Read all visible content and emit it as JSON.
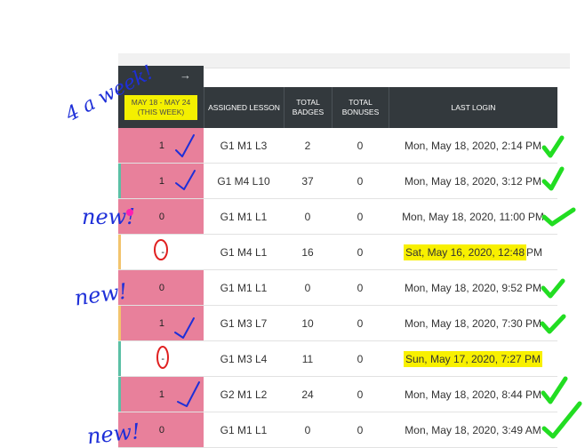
{
  "header": {
    "arrow": "→",
    "week_label_line1": "MAY 18 - MAY 24",
    "week_label_line2": "(THIS WEEK)",
    "assigned_lesson": "ASSIGNED LESSON",
    "total_badges": "TOTAL BADGES",
    "total_bonuses": "TOTAL BONUSES",
    "last_login": "LAST LOGIN"
  },
  "rows": [
    {
      "week": "1",
      "lesson": "G1 M1 L3",
      "badges": "2",
      "bonuses": "0",
      "login": "Mon, May 18, 2020, 2:14 PM"
    },
    {
      "week": "1",
      "lesson": "G1 M4 L10",
      "badges": "37",
      "bonuses": "0",
      "login": "Mon, May 18, 2020, 3:12 PM"
    },
    {
      "week": "0",
      "lesson": "G1 M1 L1",
      "badges": "0",
      "bonuses": "0",
      "login": "Mon, May 18, 2020, 11:00 PM"
    },
    {
      "week": "-",
      "lesson": "G1 M4 L1",
      "badges": "16",
      "bonuses": "0",
      "login_hl": "Sat, May 16, 2020, 12:48",
      "login_rest": " PM"
    },
    {
      "week": "0",
      "lesson": "G1 M1 L1",
      "badges": "0",
      "bonuses": "0",
      "login": "Mon, May 18, 2020, 9:52 PM"
    },
    {
      "week": "1",
      "lesson": "G1 M3 L7",
      "badges": "10",
      "bonuses": "0",
      "login": "Mon, May 18, 2020, 7:30 PM"
    },
    {
      "week": "-",
      "lesson": "G1 M3 L4",
      "badges": "11",
      "bonuses": "0",
      "login_hl": "Sun, May 17, 2020, 7:27 PM",
      "login_rest": ""
    },
    {
      "week": "1",
      "lesson": "G2 M1 L2",
      "badges": "24",
      "bonuses": "0",
      "login": "Mon, May 18, 2020, 8:44 PM"
    },
    {
      "week": "0",
      "lesson": "G1 M1 L1",
      "badges": "0",
      "bonuses": "0",
      "login": "Mon, May 18, 2020, 3:49 AM"
    }
  ],
  "annotations": {
    "note_week": "4 a week!",
    "note_new_1": "new!",
    "note_new_2": "new!",
    "note_new_3": "new!"
  },
  "colors": {
    "header_bg": "#33393d",
    "inactive_row": "#e8809b",
    "highlight": "#f8f000",
    "ink_blue": "#1e2fd8",
    "check_green": "#22dd22"
  }
}
